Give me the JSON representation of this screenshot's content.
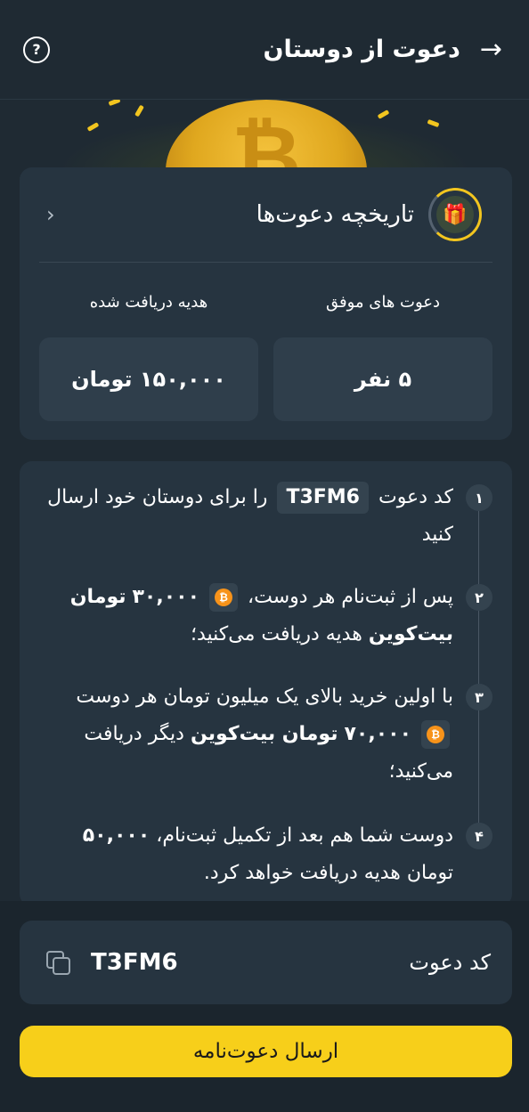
{
  "header": {
    "title": "دعوت از دوستان",
    "back_icon": "arrow-right-icon",
    "help_icon": "question-circle-icon"
  },
  "hero": {
    "symbol": "₿"
  },
  "history": {
    "title": "تاریخچه دعوت‌ها",
    "gift_icon": "gift-icon",
    "stats": [
      {
        "label": "دعوت های موفق",
        "value": "۵ نفر"
      },
      {
        "label": "هدیه دریافت شده",
        "value": "۱۵۰,۰۰۰ تومان"
      }
    ]
  },
  "steps": {
    "step1": {
      "num": "۱",
      "pre": "کد دعوت",
      "code": "T3FM6",
      "post": "را برای دوستان خود ارسال کنید"
    },
    "step2": {
      "num": "۲",
      "pre": "پس از ثبت‌نام هر دوست،",
      "amount": "۳۰,۰۰۰",
      "bold": "تومان بیت‌کوین",
      "post": "هدیه دریافت می‌کنید؛"
    },
    "step3": {
      "num": "۳",
      "pre": "با اولین خرید بالای یک میلیون تومان هر دوست",
      "amount": "۷۰,۰۰۰",
      "bold": "تومان بیت‌کوین",
      "post": "دیگر دریافت می‌کنید؛"
    },
    "step4": {
      "num": "۴",
      "pre": "دوست شما هم بعد از تکمیل ثبت‌نام،",
      "amount": "۵۰,۰۰۰",
      "post": "تومان هدیه دریافت خواهد کرد."
    }
  },
  "invite_code": {
    "label": "کد دعوت",
    "value": "T3FM6",
    "copy_icon": "copy-icon"
  },
  "send_button": "ارسال دعوت‌نامه",
  "colors": {
    "accent": "#f7cf1a",
    "background": "#1f2a33",
    "card": "#263440"
  }
}
